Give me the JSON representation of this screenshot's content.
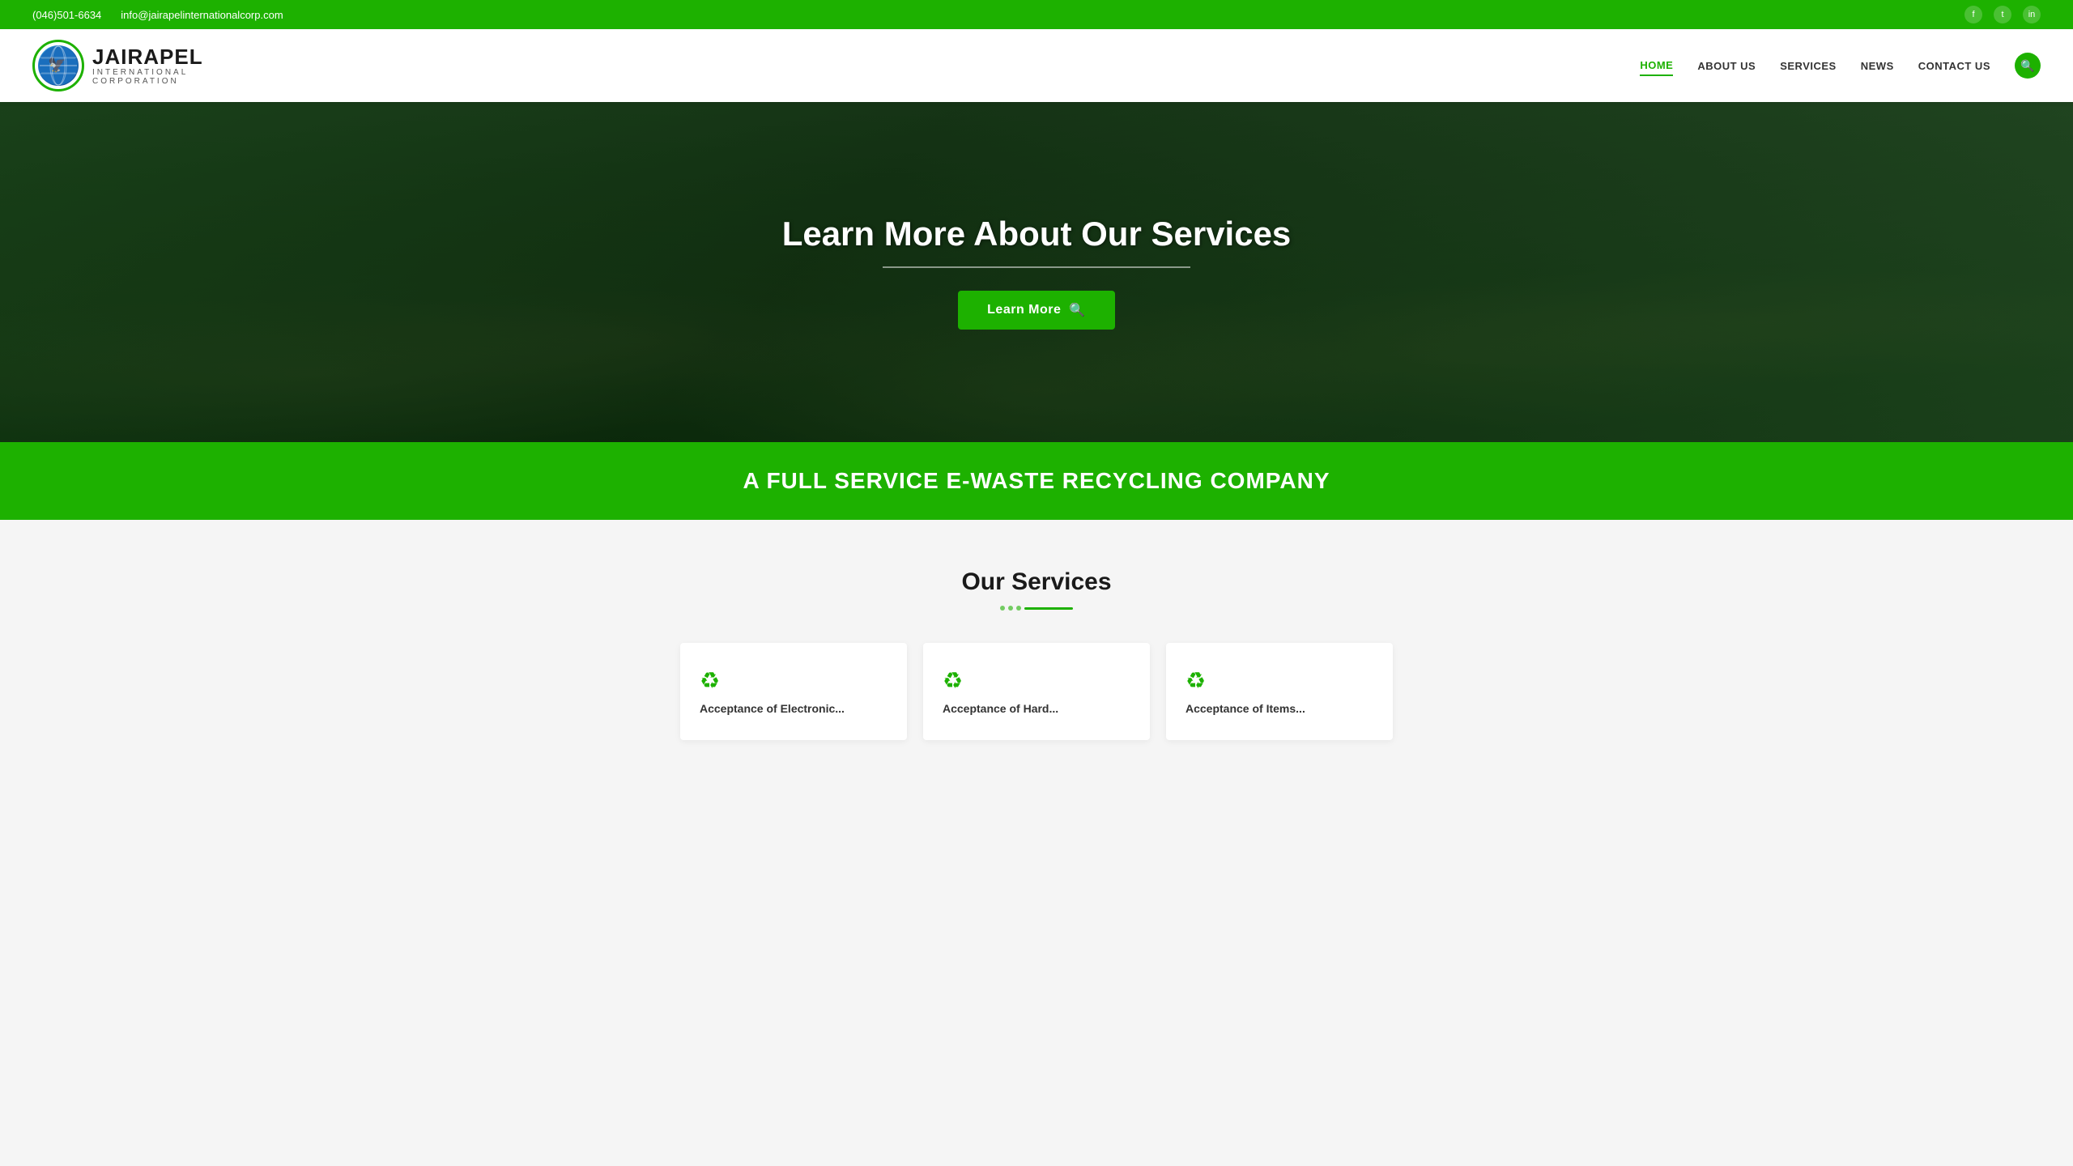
{
  "topbar": {
    "phone": "(046)501-6634",
    "email": "info@jairapelinternationalcorp.com",
    "social": [
      {
        "name": "facebook",
        "symbol": "f"
      },
      {
        "name": "twitter",
        "symbol": "t"
      },
      {
        "name": "linkedin",
        "symbol": "in"
      }
    ]
  },
  "navbar": {
    "brand": "JAIRAPEL",
    "sub1": "INTERNATIONAL",
    "sub2": "CORPORATION",
    "links": [
      {
        "label": "HOME",
        "active": true
      },
      {
        "label": "ABOUT US",
        "active": false
      },
      {
        "label": "SERVICES",
        "active": false
      },
      {
        "label": "NEWS",
        "active": false
      },
      {
        "label": "CONTACT US",
        "active": false
      }
    ]
  },
  "hero": {
    "title": "Learn More About Our Services",
    "btn_label": "Learn More",
    "search_icon": "🔍"
  },
  "green_band": {
    "text": "A FULL SERVICE E-WASTE RECYCLING COMPANY"
  },
  "services_section": {
    "title": "Our Services",
    "cards": [
      {
        "icon": "♻",
        "label": "Acceptance of Electronic..."
      },
      {
        "icon": "♻",
        "label": "Acceptance of Hard..."
      },
      {
        "icon": "♻",
        "label": "Acceptance of Items..."
      }
    ]
  }
}
